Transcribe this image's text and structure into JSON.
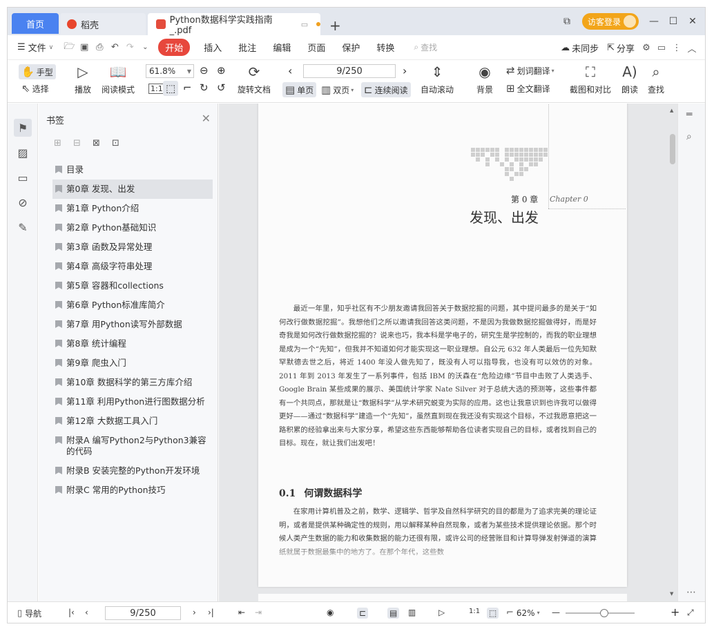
{
  "tabs": {
    "home": "首页",
    "daoke": "稻壳",
    "doc": "Python数据科学实践指南_.pdf",
    "add": "+"
  },
  "window": {
    "visitor_login": "访客登录"
  },
  "menu": {
    "file": "文件",
    "start": "开始",
    "insert": "插入",
    "annotate": "批注",
    "edit": "编辑",
    "page": "页面",
    "protect": "保护",
    "convert": "转换",
    "search": "查找",
    "sync": "未同步",
    "share": "分享"
  },
  "ribbon": {
    "hand": "手型",
    "select": "选择",
    "play": "播放",
    "reading_mode": "阅读模式",
    "zoom_value": "61.8%",
    "rotate_doc": "旋转文档",
    "page_indicator": "9/250",
    "single_page": "单页",
    "double_page": "双页",
    "continuous": "连续阅读",
    "auto_scroll": "自动滚动",
    "background": "背景",
    "word_translate": "划词翻译",
    "full_translate": "全文翻译",
    "screenshot_compare": "截图和对比",
    "read_aloud": "朗读",
    "find": "查找"
  },
  "bookmarks": {
    "title": "书签",
    "items": [
      {
        "label": "目录"
      },
      {
        "label": "第0章 发现、出发"
      },
      {
        "label": "第1章 Python介绍"
      },
      {
        "label": "第2章 Python基础知识"
      },
      {
        "label": "第3章 函数及异常处理"
      },
      {
        "label": "第4章 高级字符串处理"
      },
      {
        "label": "第5章 容器和collections"
      },
      {
        "label": "第6章 Python标准库简介"
      },
      {
        "label": "第7章 用Python读写外部数据"
      },
      {
        "label": "第8章 统计编程"
      },
      {
        "label": "第9章 爬虫入门"
      },
      {
        "label": "第10章 数据科学的第三方库介绍"
      },
      {
        "label": "第11章 利用Python进行图数据分析"
      },
      {
        "label": "第12章 大数据工具入门"
      },
      {
        "label": "附录A 编写Python2与Python3兼容的代码"
      },
      {
        "label": "附录B 安装完整的Python开发环境"
      },
      {
        "label": "附录C 常用的Python技巧"
      }
    ]
  },
  "document": {
    "chapter_num": "第 0 章",
    "chapter_en": "Chapter 0",
    "chapter_title": "发现、出发",
    "intro": "最近一年里，知乎社区有不少朋友邀请我回答关于数据挖掘的问题，其中提问最多的是关于“如何改行做数据挖掘”。我想他们之所以邀请我回答这类问题，不是因为我做数据挖掘做得好，而是好奇我是如何改行做数据挖掘的？说来也巧，我本科是学电子的，研究生是学控制的，而我的职业理想是成为一个“先知”，但我并不知道如何才能实现这一职业理想。自公元 632 年人类最后一位先知默罕默德去世之后，将近 1400 年没人做先知了，既没有人可以指导我，也没有可以效仿的对象。2011 年到 2013 年发生了一系列事件，包括 IBM 的沃森在“危险边缘”节目中击败了人类选手、Google Brain 某些成果的展示、美国统计学家 Nate Silver 对于总统大选的预测等，这些事件都有一个共同点，那就是让“数据科学”从学术研究蜕变为实际的应用。这也让我意识到也许我可以做得更好——通过“数据科学”建造一个“先知”，虽然直到现在我还没有实现这个目标，不过我愿意把这一路积累的经验拿出来与大家分享，希望这些东西能够帮助各位读者实现自己的目标，或者找到自己的目标。现在，就让我们出发吧！",
    "section_num": "0.1",
    "section_title": "何谓数据科学",
    "section_text": "在家用计算机普及之前，数学、逻辑学、哲学及自然科学研究的目的都是为了追求完美的理论证明，或者是提供某种确定性的规则，用以解释某种自然现象，或者为某些技术提供理论依据。那个时候人类产生数据的能力和收集数据的能力还很有限，或许公司的经营账目和计算导弹发射弹道的演算纸就属于数据最集中的地方了。在那个年代，这些数"
  },
  "status": {
    "nav": "导航",
    "page_indicator": "9/250",
    "zoom": "62%"
  },
  "colors": {
    "accent": "#4a82f0",
    "start_red": "#e7473c",
    "visitor_orange": "#f2a51a"
  }
}
